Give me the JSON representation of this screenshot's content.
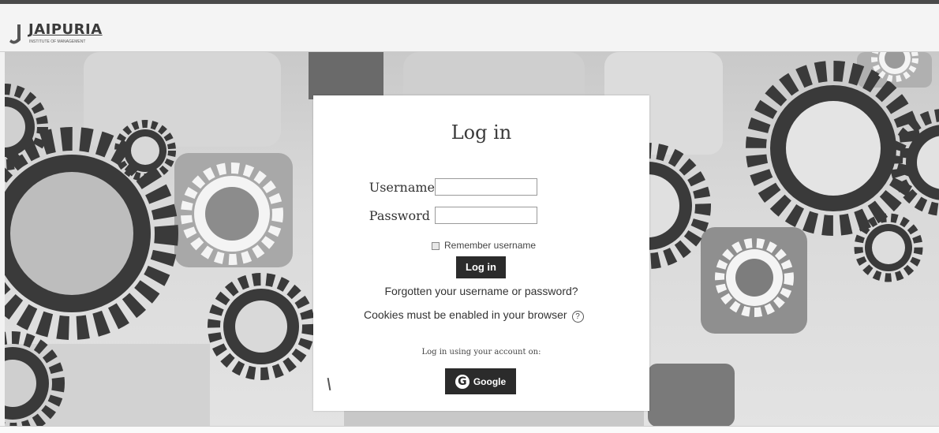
{
  "header": {
    "logo_name": "JAIPURIA",
    "logo_subtitle": "INSTITUTE OF MANAGEMENT"
  },
  "login": {
    "title": "Log in",
    "username_label": "Username",
    "username_value": "",
    "password_label": "Password",
    "password_value": "",
    "remember_label": "Remember username",
    "login_button": "Log in",
    "forgot_link": "Forgotten your username or password?",
    "cookies_notice": "Cookies must be enabled in your browser",
    "help_icon_glyph": "?",
    "oauth_label": "Log in using your account on:",
    "google_glyph": "G",
    "google_button": "Google"
  },
  "colors": {
    "button_bg": "#2b2b2b",
    "card_bg": "#ffffff",
    "gear_dark": "#3a3a3a"
  }
}
